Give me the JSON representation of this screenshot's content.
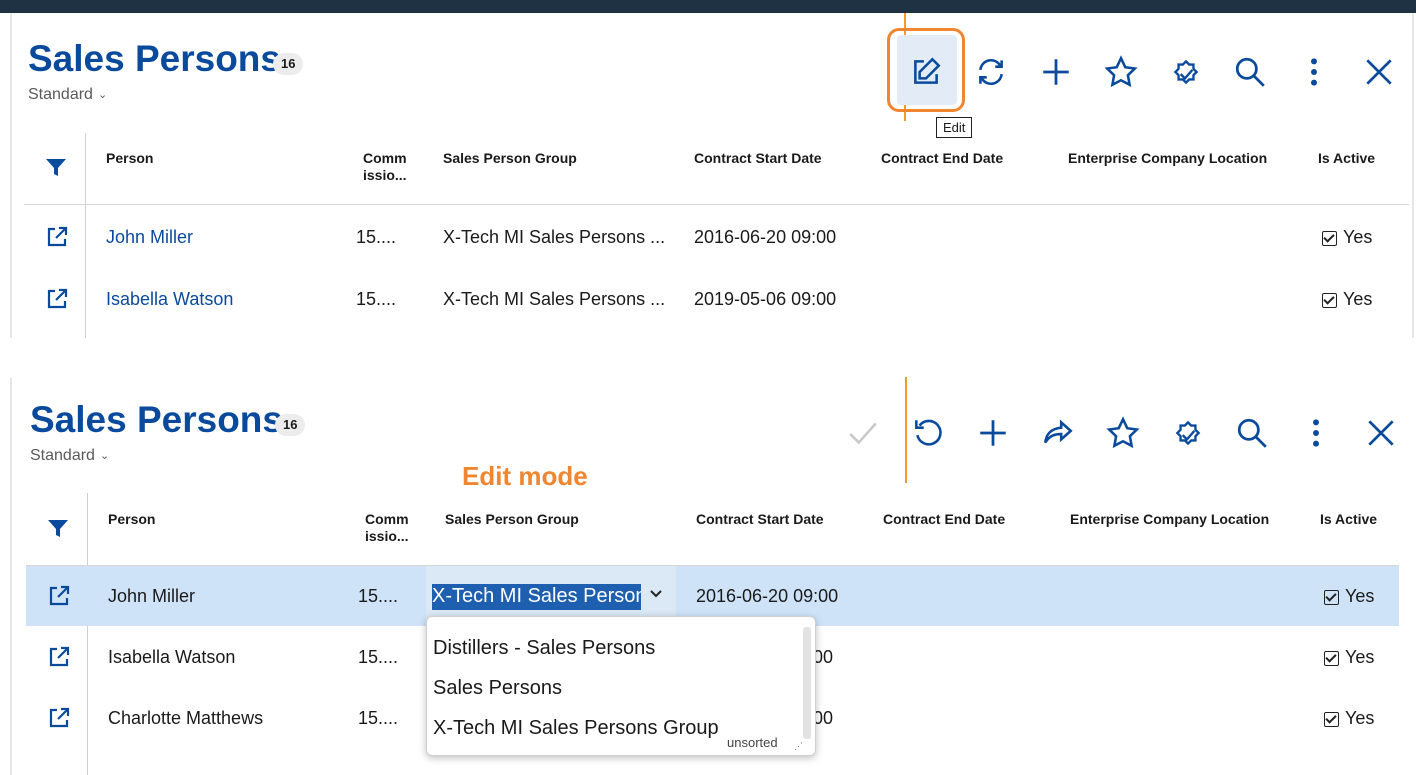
{
  "colors": {
    "brand": "#0a4a9c",
    "accent_orange": "#f0862f",
    "selected_row": "#cfe3f8",
    "topbar": "#1f3243"
  },
  "top": {
    "title": "Sales Persons",
    "count": "16",
    "variant": "Standard",
    "toolbar": [
      {
        "name": "edit-icon"
      },
      {
        "name": "refresh-icon"
      },
      {
        "name": "add-icon"
      },
      {
        "name": "star-icon"
      },
      {
        "name": "badge-check-icon"
      },
      {
        "name": "search-icon"
      },
      {
        "name": "more-vertical-icon"
      },
      {
        "name": "close-icon"
      }
    ],
    "tooltip": "Edit",
    "columns": [
      "Person",
      "Comm issio...",
      "Sales Person Group",
      "Contract Start Date",
      "Contract End Date",
      "Enterprise Company Location",
      "Is Active"
    ],
    "rows": [
      {
        "person": "John Miller",
        "commission": "15....",
        "group": "X-Tech MI Sales Persons ...",
        "start": "2016-06-20 09:00",
        "end": "",
        "location": "",
        "active": "Yes"
      },
      {
        "person": "Isabella Watson",
        "commission": "15....",
        "group": "X-Tech MI Sales Persons ...",
        "start": "2019-05-06 09:00",
        "end": "",
        "location": "",
        "active": "Yes"
      }
    ]
  },
  "bottom": {
    "title": "Sales Persons",
    "count": "16",
    "variant": "Standard",
    "mode_label": "Edit mode",
    "toolbar": [
      {
        "name": "save-check-icon"
      },
      {
        "name": "undo-icon"
      },
      {
        "name": "add-icon"
      },
      {
        "name": "share-icon"
      },
      {
        "name": "star-icon"
      },
      {
        "name": "badge-check-icon"
      },
      {
        "name": "search-icon"
      },
      {
        "name": "more-vertical-icon"
      },
      {
        "name": "close-icon"
      }
    ],
    "columns": [
      "Person",
      "Comm issio...",
      "Sales Person Group",
      "Contract Start Date",
      "Contract End Date",
      "Enterprise Company Location",
      "Is Active"
    ],
    "rows": [
      {
        "person": "John Miller",
        "commission": "15....",
        "group": "X-Tech MI Sales Persons",
        "start": "2016-06-20 09:00",
        "active": "Yes"
      },
      {
        "person": "Isabella Watson",
        "commission": "15....",
        "start_partial": "00",
        "active": "Yes"
      },
      {
        "person": "Charlotte Matthews",
        "commission": "15....",
        "start_partial": "00",
        "active": "Yes"
      }
    ],
    "dropdown": {
      "options": [
        "Distillers - Sales Persons",
        "Sales Persons",
        "X-Tech MI Sales Persons Group"
      ],
      "footer": "unsorted"
    }
  }
}
